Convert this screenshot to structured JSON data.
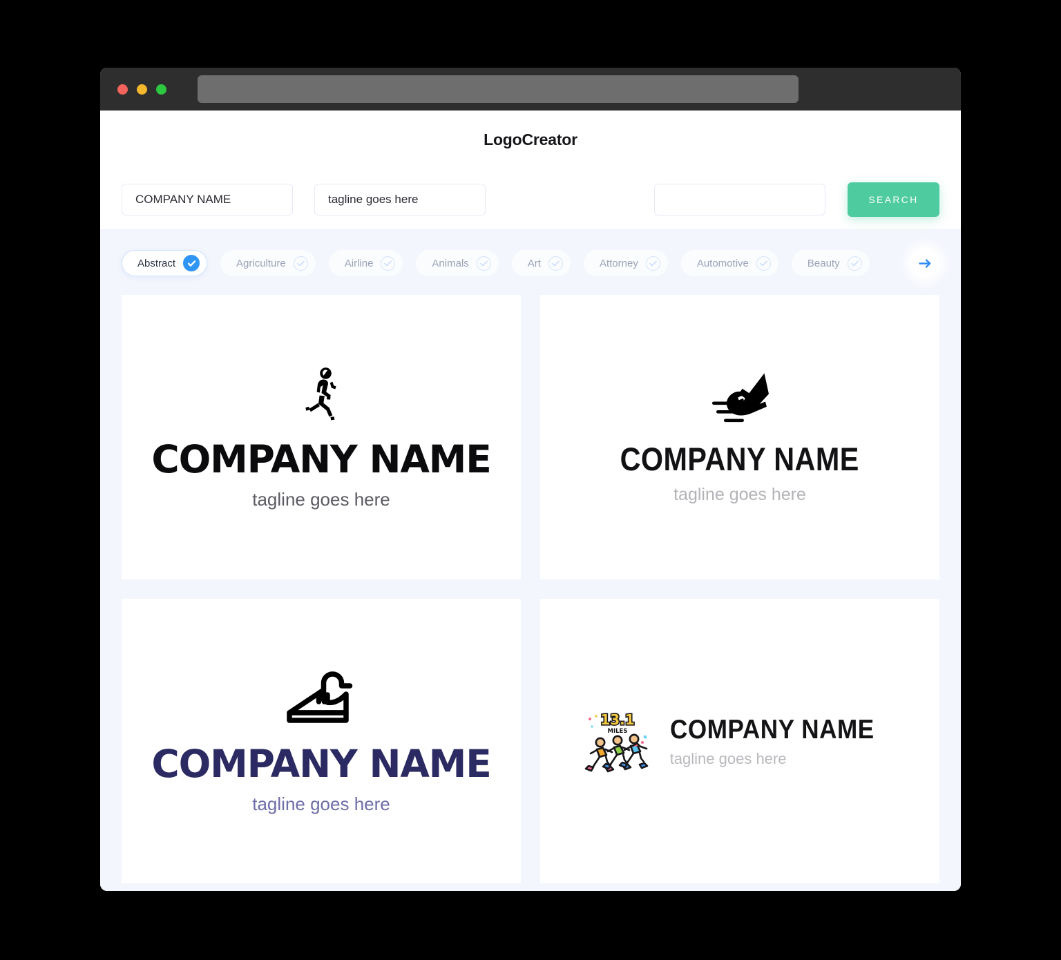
{
  "window": {
    "traffic_lights": [
      "close",
      "minimize",
      "maximize"
    ],
    "url_value": ""
  },
  "header": {
    "brand": "LogoCreator"
  },
  "search": {
    "company_name_value": "COMPANY NAME",
    "company_name_placeholder": "COMPANY NAME",
    "tagline_value": "tagline goes here",
    "tagline_placeholder": "tagline goes here",
    "third_field_value": "",
    "third_field_placeholder": "",
    "search_button_label": "SEARCH"
  },
  "categories": {
    "next_arrow_icon": "arrow-right-icon",
    "items": [
      {
        "label": "Abstract",
        "selected": true,
        "icon": "check-circle-icon"
      },
      {
        "label": "Agriculture",
        "selected": false,
        "icon": "check-circle-icon"
      },
      {
        "label": "Airline",
        "selected": false,
        "icon": "check-circle-icon"
      },
      {
        "label": "Animals",
        "selected": false,
        "icon": "check-circle-icon"
      },
      {
        "label": "Art",
        "selected": false,
        "icon": "check-circle-icon"
      },
      {
        "label": "Attorney",
        "selected": false,
        "icon": "check-circle-icon"
      },
      {
        "label": "Automotive",
        "selected": false,
        "icon": "check-circle-icon"
      },
      {
        "label": "Beauty",
        "selected": false,
        "icon": "check-circle-icon"
      }
    ]
  },
  "results": [
    {
      "name": "COMPANY NAME",
      "tagline": "tagline goes here",
      "icon": "running-man-icon",
      "name_color": "#0b0b0d",
      "tagline_color": "#5b5b63"
    },
    {
      "name": "COMPANY NAME",
      "tagline": "tagline goes here",
      "icon": "running-shoe-icon",
      "name_color": "#121215",
      "tagline_color": "#b3b3b8"
    },
    {
      "name": "COMPANY NAME",
      "tagline": "tagline goes here",
      "icon": "sneaker-outline-icon",
      "name_color": "#2b2a62",
      "tagline_color": "#6e6ea8"
    },
    {
      "name": "COMPANY NAME",
      "tagline": "tagline goes here",
      "icon": "three-runners-icon",
      "name_color": "#141417",
      "tagline_color": "#b8b8bd",
      "badge_number": "13.1",
      "badge_unit": "MILES"
    }
  ],
  "colors": {
    "accent_green": "#4FCBA0",
    "accent_blue": "#2F96F5",
    "page_background": "#F4F6FD",
    "titlebar": "#2e2e2e"
  }
}
